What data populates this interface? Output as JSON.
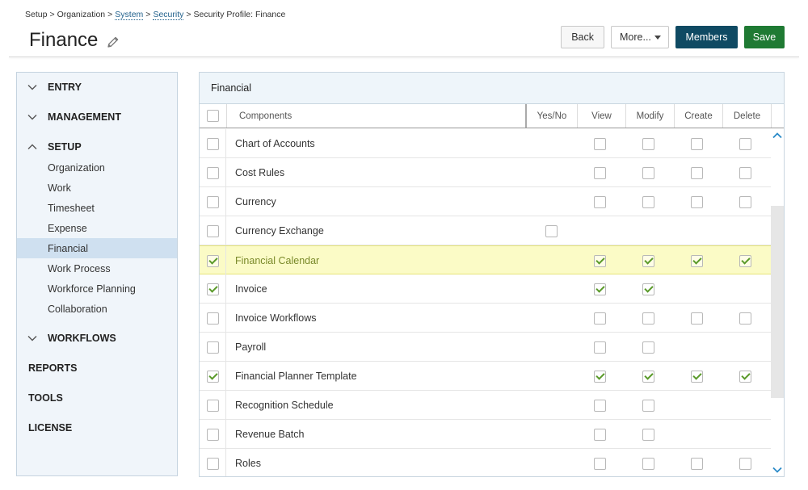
{
  "breadcrumb": {
    "setup": "Setup",
    "organization": "Organization",
    "system": "System",
    "security": "Security",
    "current": "Security Profile: Finance",
    "separator": ">"
  },
  "page": {
    "title": "Finance"
  },
  "actions": {
    "back": "Back",
    "more": "More...",
    "members": "Members",
    "save": "Save"
  },
  "sidebar": {
    "sections": [
      {
        "label": "ENTRY",
        "state": "collapsed"
      },
      {
        "label": "MANAGEMENT",
        "state": "collapsed"
      },
      {
        "label": "SETUP",
        "state": "expanded"
      },
      {
        "label": "WORKFLOWS",
        "state": "collapsed"
      },
      {
        "label": "REPORTS"
      },
      {
        "label": "TOOLS"
      },
      {
        "label": "LICENSE"
      }
    ],
    "setup_items": [
      "Organization",
      "Work",
      "Timesheet",
      "Expense",
      "Financial",
      "Work Process",
      "Workforce Planning",
      "Collaboration"
    ],
    "active_item": "Financial"
  },
  "panel": {
    "title": "Financial",
    "columns": {
      "components": "Components",
      "yesno": "Yes/No",
      "view": "View",
      "modify": "Modify",
      "create": "Create",
      "delete": "Delete"
    },
    "rows": [
      {
        "name": "Chart of Accounts",
        "selected": false,
        "yesno": null,
        "view": false,
        "modify": false,
        "create": false,
        "delete": false
      },
      {
        "name": "Cost Rules",
        "selected": false,
        "yesno": null,
        "view": false,
        "modify": false,
        "create": false,
        "delete": false
      },
      {
        "name": "Currency",
        "selected": false,
        "yesno": null,
        "view": false,
        "modify": false,
        "create": false,
        "delete": false
      },
      {
        "name": "Currency Exchange",
        "selected": false,
        "yesno": false,
        "view": null,
        "modify": null,
        "create": null,
        "delete": null
      },
      {
        "name": "Financial Calendar",
        "selected": true,
        "highlight": true,
        "yesno": null,
        "view": true,
        "modify": true,
        "create": true,
        "delete": true
      },
      {
        "name": "Invoice",
        "selected": true,
        "yesno": null,
        "view": true,
        "modify": true,
        "create": null,
        "delete": null
      },
      {
        "name": "Invoice Workflows",
        "selected": false,
        "yesno": null,
        "view": false,
        "modify": false,
        "create": false,
        "delete": false
      },
      {
        "name": "Payroll",
        "selected": false,
        "yesno": null,
        "view": false,
        "modify": false,
        "create": null,
        "delete": null
      },
      {
        "name": "Financial Planner Template",
        "selected": true,
        "yesno": null,
        "view": true,
        "modify": true,
        "create": true,
        "delete": true
      },
      {
        "name": "Recognition Schedule",
        "selected": false,
        "yesno": null,
        "view": false,
        "modify": false,
        "create": null,
        "delete": null
      },
      {
        "name": "Revenue Batch",
        "selected": false,
        "yesno": null,
        "view": false,
        "modify": false,
        "create": null,
        "delete": null
      },
      {
        "name": "Roles",
        "selected": false,
        "yesno": null,
        "view": false,
        "modify": false,
        "create": false,
        "delete": false
      }
    ]
  },
  "colors": {
    "members_button": "#0f4a63",
    "save_button": "#1f7a33",
    "sidebar_bg": "#f0f5fa",
    "sidebar_active": "#cfe0f0",
    "row_highlight": "#fbfbc6",
    "check_mark": "#5a9a2a",
    "link": "#1f5f8b"
  },
  "icons": {
    "edit": "pencil-icon",
    "collapsed": "chevron-down-icon",
    "expanded": "chevron-up-icon",
    "scroll_up": "scroll-up-icon",
    "scroll_down": "scroll-down-icon"
  }
}
